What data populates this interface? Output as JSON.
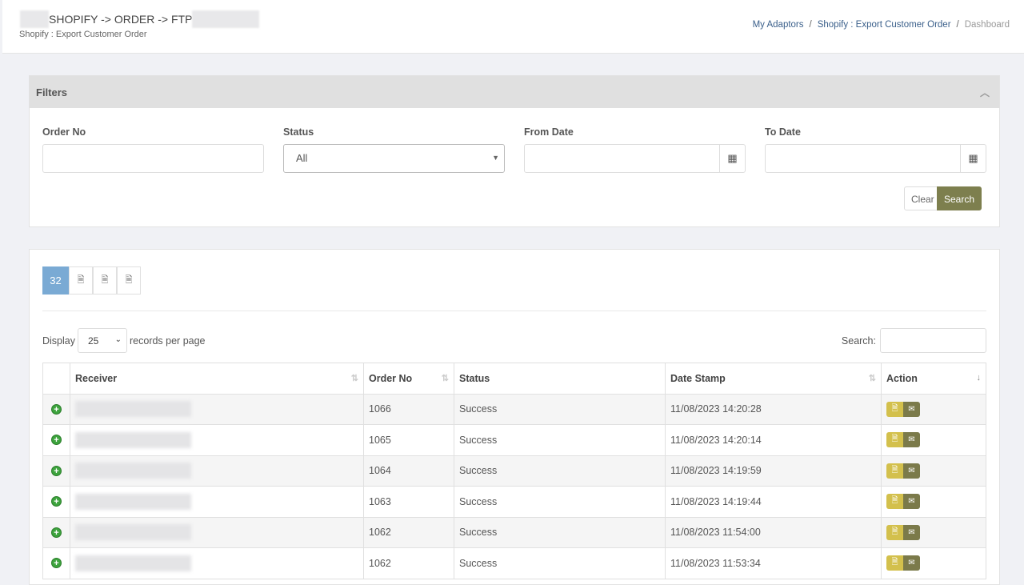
{
  "header": {
    "title": "SHOPIFY -> ORDER -> FTP",
    "subtitle": "Shopify : Export Customer Order",
    "breadcrumbs": [
      "My Adaptors",
      "Shopify : Export Customer Order",
      "Dashboard"
    ]
  },
  "filters": {
    "title": "Filters",
    "order_no_label": "Order No",
    "status_label": "Status",
    "status_value": "All",
    "from_date_label": "From Date",
    "to_date_label": "To Date",
    "clear_label": "Clear",
    "search_label": "Search"
  },
  "list": {
    "count": "32",
    "display_label": "Display",
    "per_page": "25",
    "records_label": "records per page",
    "search_label": "Search:",
    "columns": [
      "Receiver",
      "Order No",
      "Status",
      "Date Stamp",
      "Action"
    ],
    "rows": [
      {
        "order": "1066",
        "status": "Success",
        "date": "11/08/2023 14:20:28"
      },
      {
        "order": "1065",
        "status": "Success",
        "date": "11/08/2023 14:20:14"
      },
      {
        "order": "1064",
        "status": "Success",
        "date": "11/08/2023 14:19:59"
      },
      {
        "order": "1063",
        "status": "Success",
        "date": "11/08/2023 14:19:44"
      },
      {
        "order": "1062",
        "status": "Success",
        "date": "11/08/2023 11:54:00"
      },
      {
        "order": "1062",
        "status": "Success",
        "date": "11/08/2023 11:53:34"
      }
    ]
  },
  "colors": {
    "accent": "#7d7f4e",
    "count_badge": "#7aaad4",
    "excel_button": "#d3c04c",
    "mail_button": "#7b7a4a",
    "expand": "#3da33d"
  }
}
